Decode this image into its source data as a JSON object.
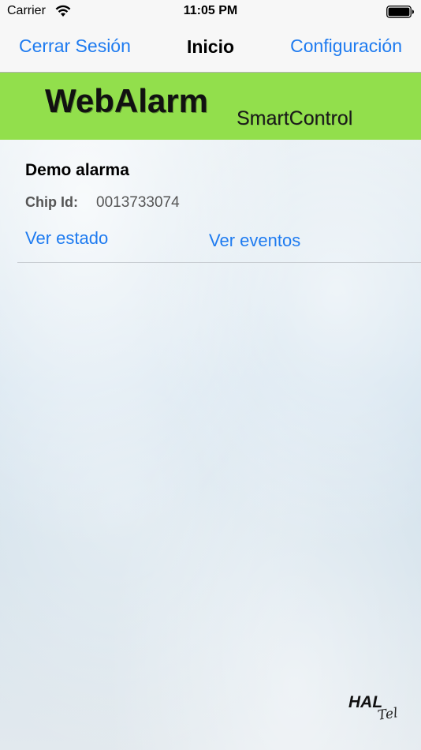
{
  "status_bar": {
    "carrier": "Carrier",
    "time": "11:05 PM",
    "wifi_icon": "wifi-icon",
    "battery_icon": "battery-icon"
  },
  "nav": {
    "left_button": "Cerrar Sesión",
    "title": "Inicio",
    "right_button": "Configuración",
    "accent_color": "#1e7bf0"
  },
  "banner": {
    "title": "WebAlarm",
    "subtitle": "SmartControl",
    "background_color": "#92df4c"
  },
  "alarm": {
    "name": "Demo alarma",
    "chip_label": "Chip Id:",
    "chip_id": "0013733074",
    "view_status": "Ver estado",
    "view_events": "Ver eventos"
  },
  "footer_logo": {
    "main": "HAL",
    "script": "Tel"
  }
}
